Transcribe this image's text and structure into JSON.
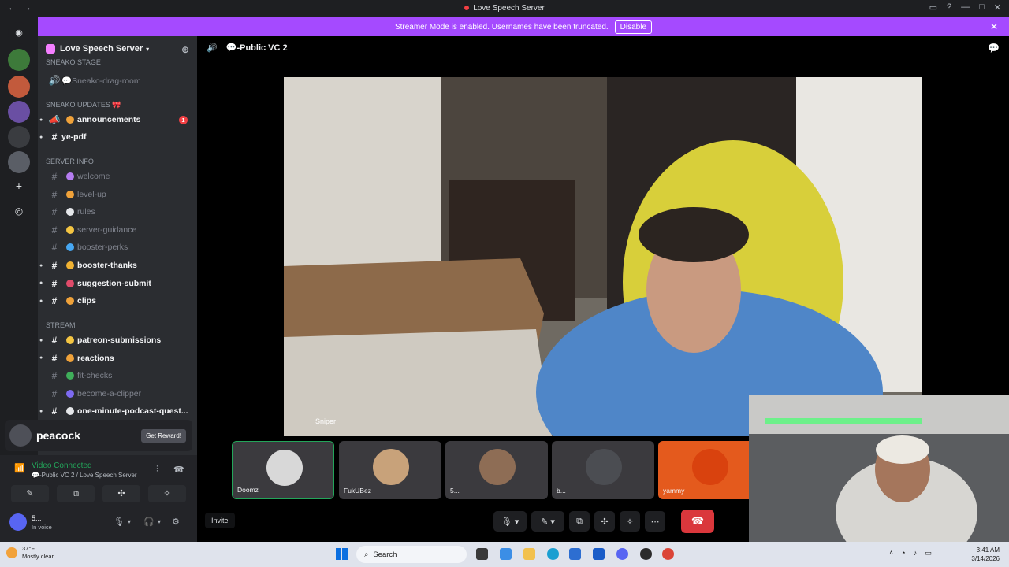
{
  "window": {
    "title": "Love Speech Server"
  },
  "streamer_banner": {
    "text": "Streamer Mode is enabled. Usernames have been truncated.",
    "disable_label": "Disable"
  },
  "server": {
    "name": "Love Speech Server"
  },
  "channels_top": [
    {
      "label": "SNEAKO STAGE",
      "kind": "category"
    },
    {
      "label": "💬Sneako-drag-room",
      "kind": "voice"
    }
  ],
  "category_updates": "SNEAKO UPDATES 🎀",
  "ch_announcements": "announcements",
  "ch_announcements_badge": "1",
  "ch_yepdf": "ye-pdf",
  "category_serverinfo": "SERVER INFO",
  "serverinfo": [
    {
      "label": "welcome",
      "unread": false,
      "color": "#b57cf0"
    },
    {
      "label": "level-up",
      "unread": false,
      "color": "#f0a23a"
    },
    {
      "label": "rules",
      "unread": false,
      "color": "#e5e7ea"
    },
    {
      "label": "server-guidance",
      "unread": false,
      "color": "#f4c542"
    },
    {
      "label": "booster-perks",
      "unread": false,
      "color": "#46a7f2"
    },
    {
      "label": "booster-thanks",
      "unread": true,
      "color": "#f0b232"
    },
    {
      "label": "suggestion-submit",
      "unread": true,
      "color": "#e04b6a"
    },
    {
      "label": "clips",
      "unread": true,
      "color": "#f0a23a"
    }
  ],
  "category_stream": "STREAM",
  "stream": [
    {
      "label": "patreon-submissions",
      "unread": true,
      "color": "#f4c542"
    },
    {
      "label": "reactions",
      "unread": true,
      "color": "#f0a23a"
    },
    {
      "label": "fit-checks",
      "unread": false,
      "color": "#3fae5a"
    },
    {
      "label": "become-a-clipper",
      "unread": false,
      "color": "#7d6af0"
    },
    {
      "label": "one-minute-podcast-quest...",
      "unread": true,
      "color": "#e5e7ea"
    }
  ],
  "promo": {
    "name": "peacock",
    "reward": "Get Reward!"
  },
  "voice": {
    "status": "Video Connected",
    "sub": "💬-Public VC 2 / Love Speech Server"
  },
  "user": {
    "name": "5...",
    "status": "In voice"
  },
  "stage": {
    "channel": "💬-Public VC 2",
    "overlay": "Sniper",
    "invite": "Invite"
  },
  "tiles": [
    {
      "name": "Doomz",
      "color": "#d8d8d8"
    },
    {
      "name": "FukUBez",
      "color": "#c8a27a"
    },
    {
      "name": "5...",
      "color": "#8e6d55"
    },
    {
      "name": "b...",
      "color": "#4b4d52"
    },
    {
      "name": "yammy",
      "color": "#d9420e"
    }
  ],
  "taskbar": {
    "temp": "37°F",
    "weather": "Mostly clear",
    "search": "Search",
    "time": "3:41 AM",
    "date": "3/14/2026"
  }
}
